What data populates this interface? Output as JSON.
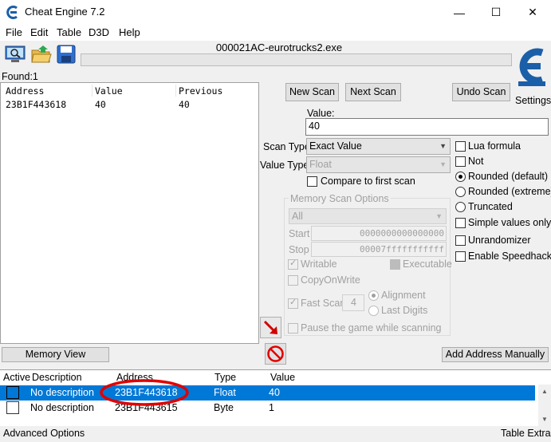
{
  "window": {
    "title": "Cheat Engine 7.2",
    "minimize": "—",
    "maximize": "☐",
    "close": "✕"
  },
  "menu": [
    "File",
    "Edit",
    "Table",
    "D3D",
    "Help"
  ],
  "toolbar": {
    "icons": [
      "open-process-icon",
      "open-file-icon",
      "save-icon"
    ]
  },
  "process_name": "000021AC-eurotrucks2.exe",
  "logo": {
    "label": "Settings"
  },
  "found_label": "Found:1",
  "scan_results": {
    "headers": [
      "Address",
      "Value",
      "Previous"
    ],
    "rows": [
      {
        "address": "23B1F443618",
        "value": "40",
        "previous": "40"
      }
    ]
  },
  "scan_buttons": {
    "new_scan": "New Scan",
    "next_scan": "Next Scan",
    "undo_scan": "Undo Scan"
  },
  "value_field": {
    "label": "Value:",
    "value": "40"
  },
  "scan_type": {
    "label": "Scan Type",
    "selected": "Exact Value"
  },
  "value_type": {
    "label": "Value Type",
    "selected": "Float"
  },
  "compare_first": "Compare to first scan",
  "right_options": {
    "lua_formula": "Lua formula",
    "not": "Not",
    "rounded_default": "Rounded (default)",
    "rounded_extreme": "Rounded (extreme)",
    "truncated": "Truncated",
    "simple_values": "Simple values only",
    "unrandomizer": "Unrandomizer",
    "speedhack": "Enable Speedhack"
  },
  "memory_scan": {
    "title": "Memory Scan Options",
    "region": "All",
    "start_label": "Start",
    "start_value": "0000000000000000",
    "stop_label": "Stop",
    "stop_value": "00007fffffffffff",
    "writable": "Writable",
    "executable": "Executable",
    "copy_on_write": "CopyOnWrite",
    "fast_scan": "Fast Scan",
    "fast_scan_value": "4",
    "alignment": "Alignment",
    "last_digits": "Last Digits",
    "pause_game": "Pause the game while scanning"
  },
  "memory_view": "Memory View",
  "add_address": "Add Address Manually",
  "address_list": {
    "headers": [
      "Active",
      "Description",
      "Address",
      "Type",
      "Value"
    ],
    "rows": [
      {
        "description": "No description",
        "address": "23B1F443618",
        "type": "Float",
        "value": "40",
        "selected": true
      },
      {
        "description": "No description",
        "address": "23B1F443615",
        "type": "Byte",
        "value": "1",
        "selected": false
      }
    ]
  },
  "bottom": {
    "advanced": "Advanced Options",
    "table_extras": "Table Extras"
  },
  "colors": {
    "selection": "#0078d7",
    "annotation": "#e00000",
    "logo": "#1b5fa8"
  }
}
